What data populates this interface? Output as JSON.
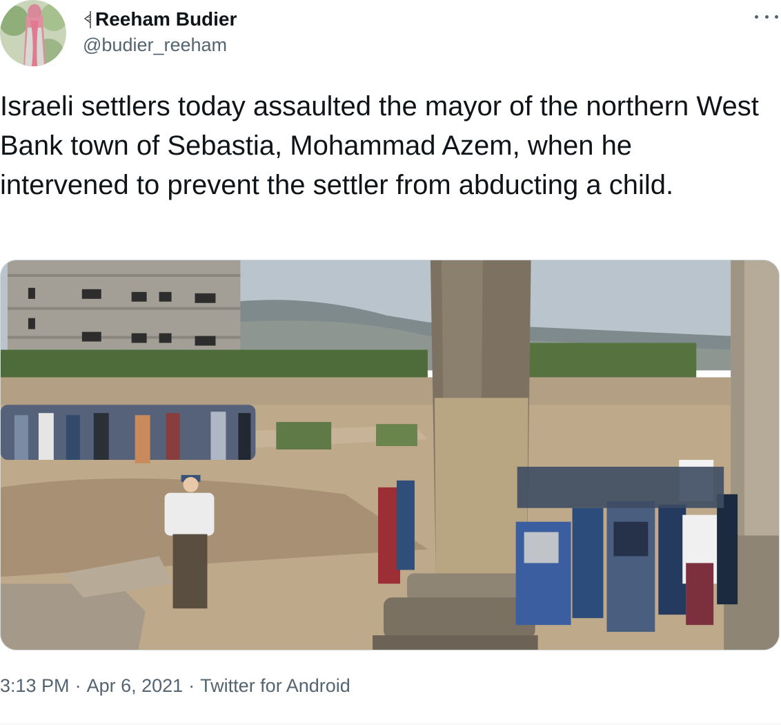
{
  "author": {
    "display_name": "Reeham Budier",
    "handle": "@budier_reeham",
    "flag_icon": "palestine-flag-icon"
  },
  "tweet": {
    "text": "Israeli settlers today assaulted the mayor of the northern West Bank town of Sebastia, Mohammad Azem, when he intervened to prevent the settler from abducting a child."
  },
  "meta": {
    "time": "3:13 PM",
    "date": "Apr 6, 2021",
    "separator": "·",
    "source": "Twitter for Android"
  },
  "icons": {
    "more": "more-dots-icon"
  },
  "colors": {
    "text_primary": "#0f1419",
    "text_secondary": "#536471",
    "border": "#cfd9de"
  }
}
